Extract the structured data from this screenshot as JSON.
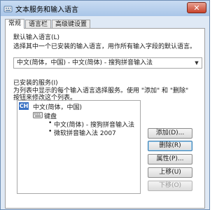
{
  "window": {
    "title": "文本服务和输入语言",
    "close_symbol": "✕"
  },
  "tabs": [
    {
      "label": "常规"
    },
    {
      "label": "语言栏"
    },
    {
      "label": "高级键设置"
    }
  ],
  "default_language": {
    "heading": "默认输入语言(L)",
    "description": "选择其中一个已安装的输入语言，用作所有输入字段的默认语言。",
    "selected": "中文(简体，中国) - 中文(简体) - 搜狗拼音输入法"
  },
  "installed_services": {
    "heading": "已安装的服务(I)",
    "description_line1": "为列表中显示的每个输入语言选择服务。使用 \"添加\" 和 \"删除\"",
    "description_line2": "按钮来修改这个列表。",
    "tree": {
      "language_badge": "CH",
      "language": "中文(简体，中国)",
      "category": "键盘",
      "items": [
        "中文(简体) - 搜狗拼音输入法",
        "微软拼音输入法 2007"
      ],
      "bullet": "•"
    }
  },
  "buttons": {
    "add": "添加(D)...",
    "remove": "删除(R)",
    "properties": "属性(P)...",
    "move_up": "上移(U)",
    "move_down": "下移(O)"
  },
  "icons": {
    "title": "keyboard-globe-icon",
    "dropdown": "chevron-down-icon",
    "keyboard": "keyboard-icon"
  }
}
